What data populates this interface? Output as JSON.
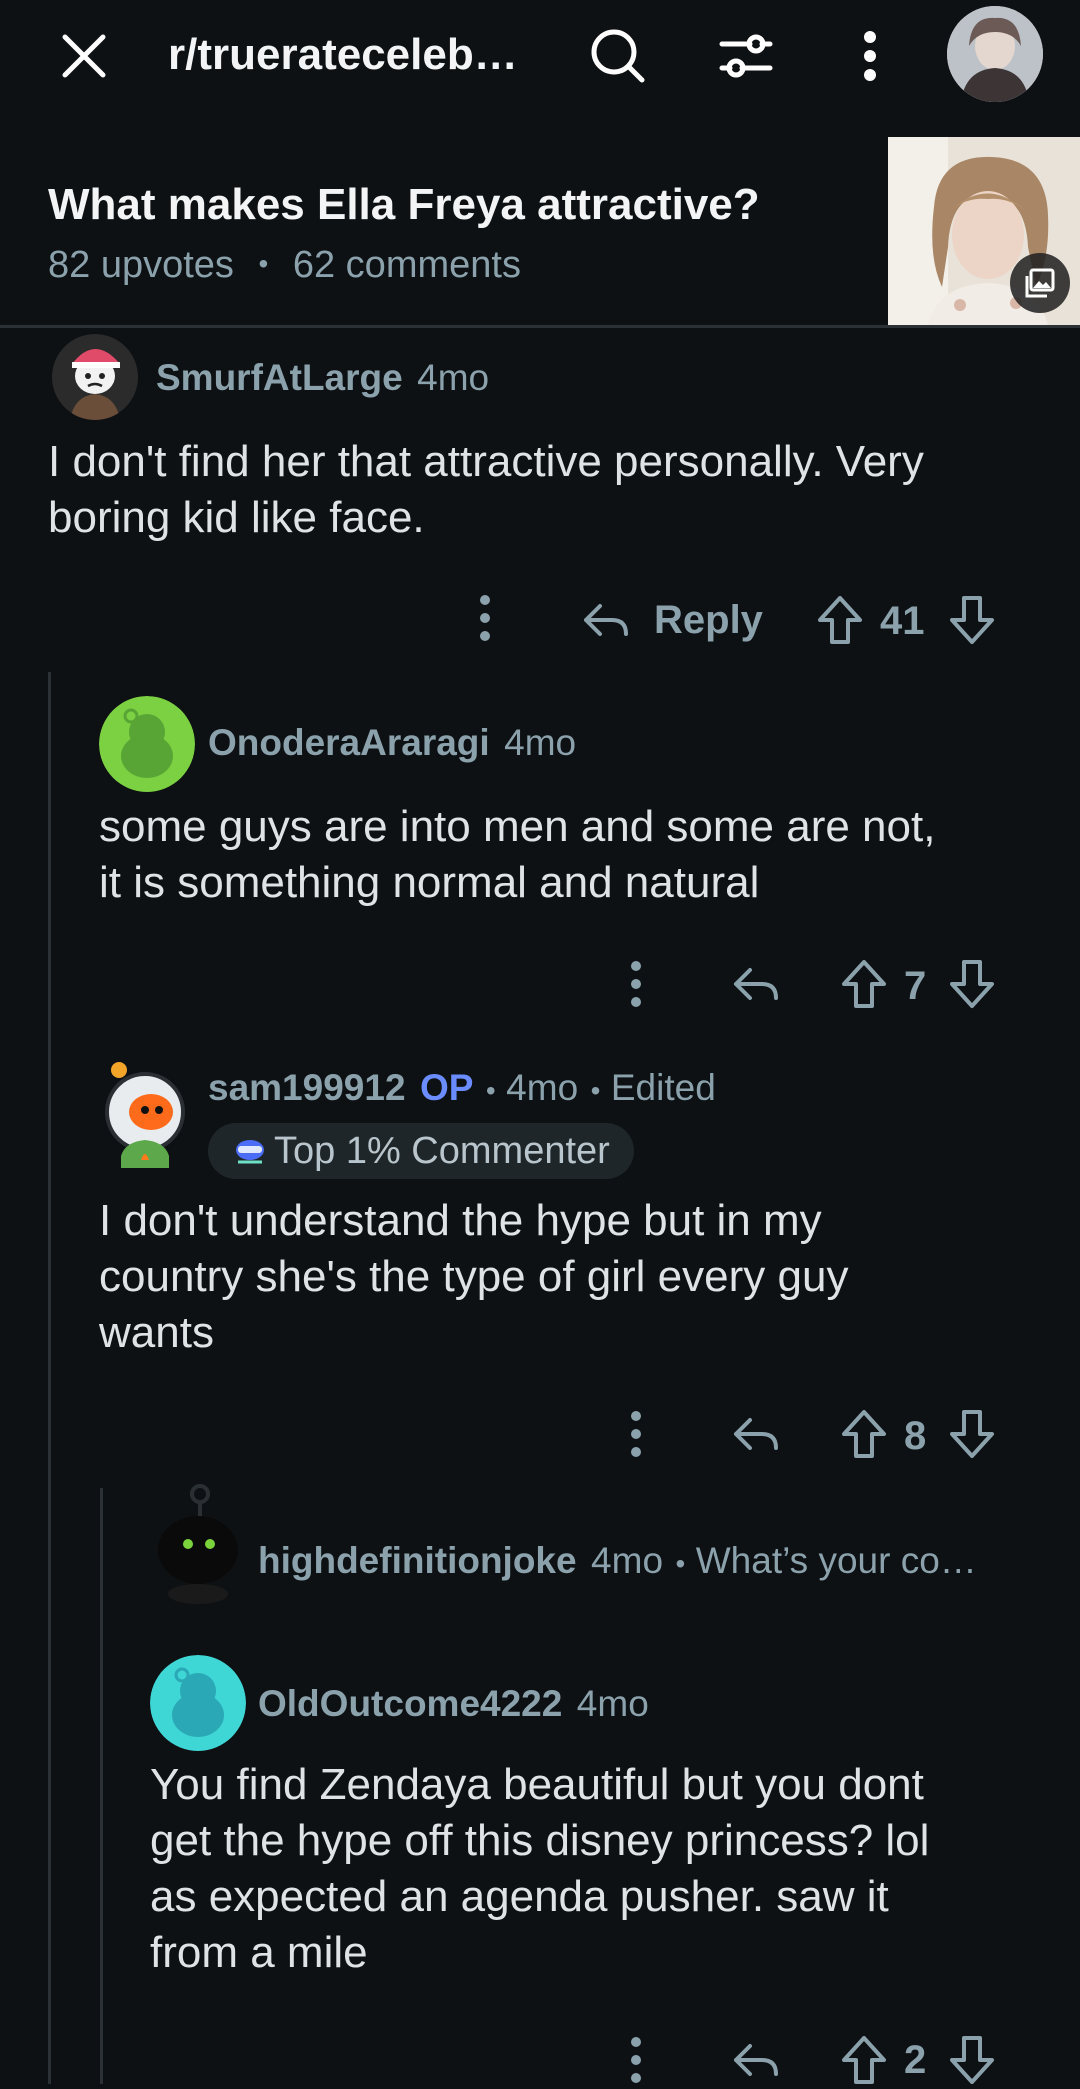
{
  "header": {
    "subreddit": "r/trueratecelebrities",
    "subreddit_display": "r/truerateceleb…"
  },
  "post": {
    "title": "What makes Ella Freya attractive?",
    "upvotes": "82 upvotes",
    "separator": "•",
    "comments": "62 comments"
  },
  "comments": [
    {
      "username": "SmurfAtLarge",
      "age": "4mo",
      "body_lines": [
        "I don't find her that attractive personally. Very",
        "boring kid like face."
      ],
      "reply_label": "Reply",
      "score": "41"
    },
    {
      "username": "OnoderaAraragi",
      "age": "4mo",
      "body_lines": [
        "some guys are into men and some are not,",
        "it is something normal and natural"
      ],
      "score": "7"
    },
    {
      "username": "sam199912",
      "op_label": "OP",
      "sep": "•",
      "age": "4mo",
      "edited": "Edited",
      "flair": "Top 1% Commenter",
      "body_lines": [
        "I don't understand the hype but in my",
        "country she's the type of girl every guy",
        "wants"
      ],
      "score": "8"
    },
    {
      "username": "highdefinitionjoke",
      "age": "4mo",
      "sep": "•",
      "collapsed_preview": "What’s your co…"
    },
    {
      "username": "OldOutcome4222",
      "age": "4mo",
      "body_lines": [
        "You find Zendaya beautiful but you dont",
        "get the hype off this disney princess? lol",
        "as expected an agenda pusher. saw it",
        "from a mile"
      ],
      "score": "2"
    }
  ],
  "colors": {
    "background": "#0e1113",
    "muted": "#8ba2ad",
    "op_blue": "#6a8cff",
    "thread_line": "#2a3236"
  },
  "icons": [
    "close-icon",
    "search-icon",
    "filter-icon",
    "more-vertical-icon",
    "user-avatar",
    "gallery-icon",
    "reply-icon",
    "upvote-icon",
    "downvote-icon"
  ]
}
